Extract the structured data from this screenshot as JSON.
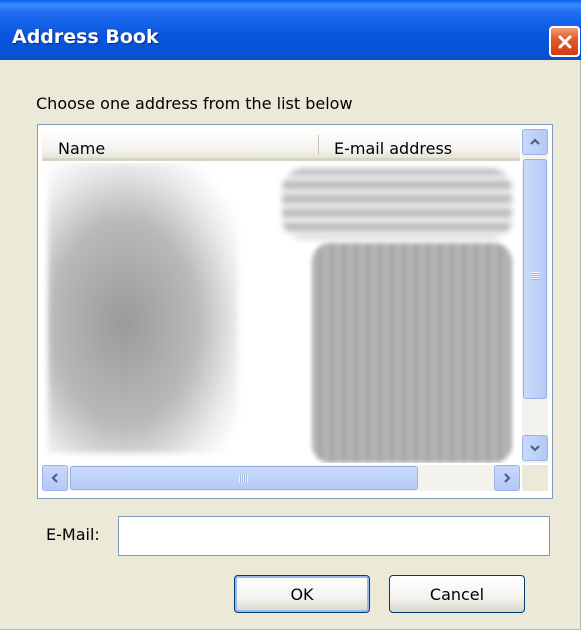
{
  "window": {
    "title": "Address Book"
  },
  "instruction_text": "Choose one address from the list below",
  "list": {
    "columns": [
      "Name",
      "E-mail address"
    ]
  },
  "email": {
    "label": "E-Mail:",
    "value": ""
  },
  "buttons": {
    "ok": "OK",
    "cancel": "Cancel"
  },
  "icons": {
    "close": "close-icon",
    "scroll_up": "chevron-up-icon",
    "scroll_down": "chevron-down-icon",
    "scroll_left": "chevron-left-icon",
    "scroll_right": "chevron-right-icon"
  },
  "colors": {
    "titlebar": "#0853d6",
    "close_button": "#e45a2d",
    "dialog_background": "#ece9d8"
  }
}
